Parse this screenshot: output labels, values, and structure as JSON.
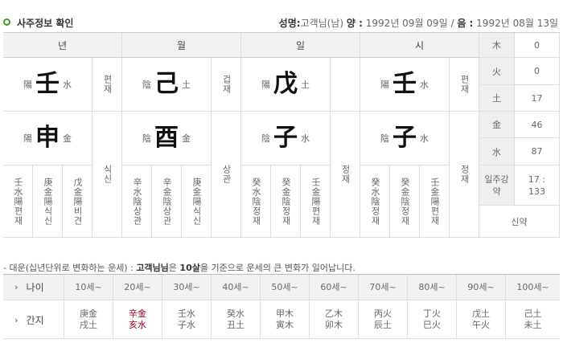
{
  "header": {
    "title": "사주정보 확인",
    "name_label": "성명:",
    "name_value": "고객님(남)",
    "yang_label": "양 :",
    "yang_value": "1992년 09월 09일",
    "sep": "/",
    "eum_label": "음 :",
    "eum_value": "1992년 08월 13일"
  },
  "pillars": {
    "headers": [
      "년",
      "월",
      "일",
      "시"
    ],
    "year": {
      "stem_ey": "陽",
      "stem": "壬",
      "stem_el": "水",
      "branch_ey": "陽",
      "branch": "申",
      "branch_el": "金",
      "stem_god": "편재",
      "branch_god": "식신",
      "hidden": [
        [
          "壬",
          "水",
          "陽",
          "편",
          "재"
        ],
        [
          "庚",
          "金",
          "陽",
          "식",
          "신"
        ],
        [
          "戊",
          "金",
          "陽",
          "비",
          "견"
        ]
      ]
    },
    "month": {
      "stem_ey": "陰",
      "stem": "己",
      "stem_el": "土",
      "branch_ey": "陰",
      "branch": "酉",
      "branch_el": "金",
      "stem_god": "겁재",
      "branch_god": "상관",
      "hidden": [
        [
          "辛",
          "水",
          "陰",
          "상",
          "관"
        ],
        [
          "辛",
          "金",
          "陰",
          "상",
          "관"
        ],
        [
          "庚",
          "金",
          "陽",
          "식",
          "신"
        ]
      ]
    },
    "day": {
      "stem_ey": "陽",
      "stem": "戊",
      "stem_el": "土",
      "branch_ey": "陰",
      "branch": "子",
      "branch_el": "水",
      "stem_god": "",
      "branch_god": "정재",
      "hidden": [
        [
          "癸",
          "水",
          "陰",
          "정",
          "재"
        ],
        [
          "癸",
          "金",
          "陰",
          "정",
          "재"
        ],
        [
          "壬",
          "金",
          "陽",
          "편",
          "재"
        ]
      ]
    },
    "hour": {
      "stem_ey": "陽",
      "stem": "壬",
      "stem_el": "水",
      "branch_ey": "陰",
      "branch": "子",
      "branch_el": "水",
      "stem_god": "편재",
      "branch_god": "정재",
      "hidden": [
        [
          "癸",
          "水",
          "陰",
          "정",
          "재"
        ],
        [
          "癸",
          "金",
          "陰",
          "정",
          "재"
        ],
        [
          "壬",
          "金",
          "陽",
          "편",
          "재"
        ]
      ]
    }
  },
  "elements": [
    {
      "name": "木",
      "value": "0"
    },
    {
      "name": "火",
      "value": "0"
    },
    {
      "name": "土",
      "value": "17"
    },
    {
      "name": "金",
      "value": "46"
    },
    {
      "name": "水",
      "value": "87"
    }
  ],
  "ilju_label": "일주강약",
  "ilju_value": "17 : 133",
  "strength": "신약",
  "note": {
    "prefix": "- 대운(십년단위로 변화하는 운세) :",
    "name": "고객님님",
    "mid": "은",
    "age": "10살",
    "suffix": "을 기준으로 운세의 큰 변화가 일어납니다."
  },
  "daeun": {
    "age_label": "나이",
    "ganji_label": "간지",
    "ages": [
      "10세~",
      "20세~",
      "30세~",
      "40세~",
      "50세~",
      "60세~",
      "70세~",
      "80세~",
      "90세~",
      "100세~"
    ],
    "ganji": [
      [
        "庚金",
        "戌土"
      ],
      [
        "辛金",
        "亥水"
      ],
      [
        "壬水",
        "子水"
      ],
      [
        "癸水",
        "丑土"
      ],
      [
        "甲木",
        "寅木"
      ],
      [
        "乙木",
        "卯木"
      ],
      [
        "丙火",
        "辰土"
      ],
      [
        "丁火",
        "巳火"
      ],
      [
        "戊土",
        "午火"
      ],
      [
        "己土",
        "未土"
      ]
    ],
    "highlight_index": 1,
    "highlight_color": "#a0001e"
  }
}
